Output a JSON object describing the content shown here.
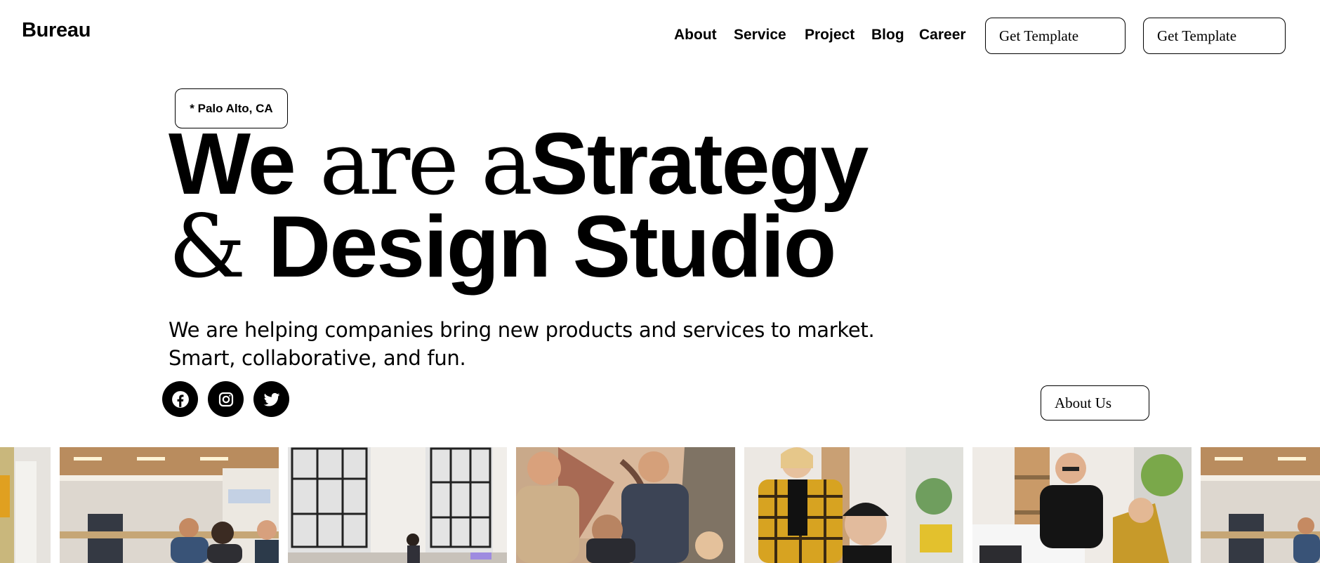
{
  "header": {
    "brand": "Bureau",
    "nav": [
      "About",
      "Service",
      "Project",
      "Blog",
      "Career"
    ],
    "cta_buttons": [
      "Get Template",
      "Get Template"
    ]
  },
  "hero": {
    "location": "* Palo Alto, CA",
    "headline": {
      "line1": [
        {
          "text": "We",
          "style": "sans-bold"
        },
        {
          "text": " are a",
          "style": "serif"
        },
        {
          "text": "Strategy",
          "style": "sans-bold"
        }
      ],
      "line2": [
        {
          "text": "& ",
          "style": "serif"
        },
        {
          "text": "Design Studio",
          "style": "sans-bold"
        }
      ]
    },
    "subtitle_line1": "We are helping companies bring new products and services to market.",
    "subtitle_line2": "Smart, collaborative, and fun.",
    "social_icons": [
      "facebook-icon",
      "instagram-icon",
      "twitter-icon"
    ],
    "about_button": "About Us"
  },
  "gallery": {
    "photos": [
      "office-workspace-photo",
      "office-window-photo",
      "team-laughing-photo",
      "coworkers-plaid-shirt-photo",
      "smiling-man-desk-photo",
      "office-workspace-photo"
    ]
  },
  "colors": {
    "background": "#ffffff",
    "text": "#000000",
    "border": "#000000"
  }
}
